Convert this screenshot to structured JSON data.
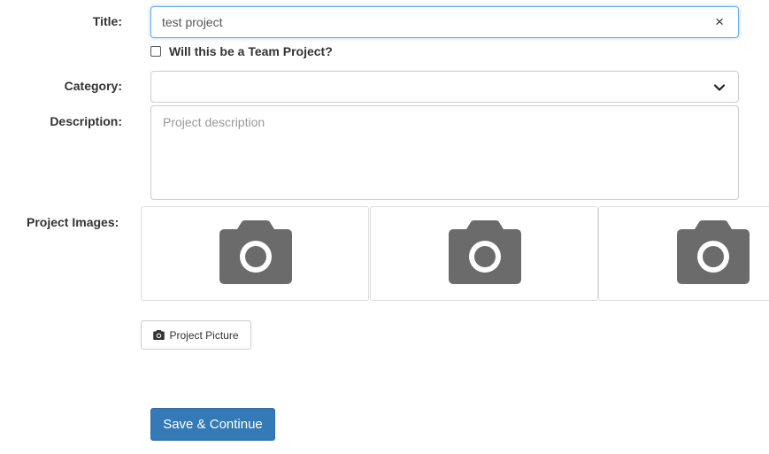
{
  "form": {
    "title_label": "Title:",
    "title_value": "test project",
    "clear_symbol": "×",
    "team_checkbox_label": "Will this be a Team Project?",
    "team_checkbox_checked": false,
    "category_label": "Category:",
    "category_value": "",
    "description_label": "Description:",
    "description_placeholder": "Project description",
    "images_label": "Project Images:",
    "image_tiles": [
      {
        "icon": "camera-icon"
      },
      {
        "icon": "camera-icon"
      },
      {
        "icon": "camera-icon"
      }
    ],
    "picture_button_label": "Project Picture",
    "save_button_label": "Save & Continue"
  },
  "colors": {
    "primary": "#337ab7",
    "icon_gray": "#6b6b6b",
    "focus_border": "#66afe9"
  }
}
